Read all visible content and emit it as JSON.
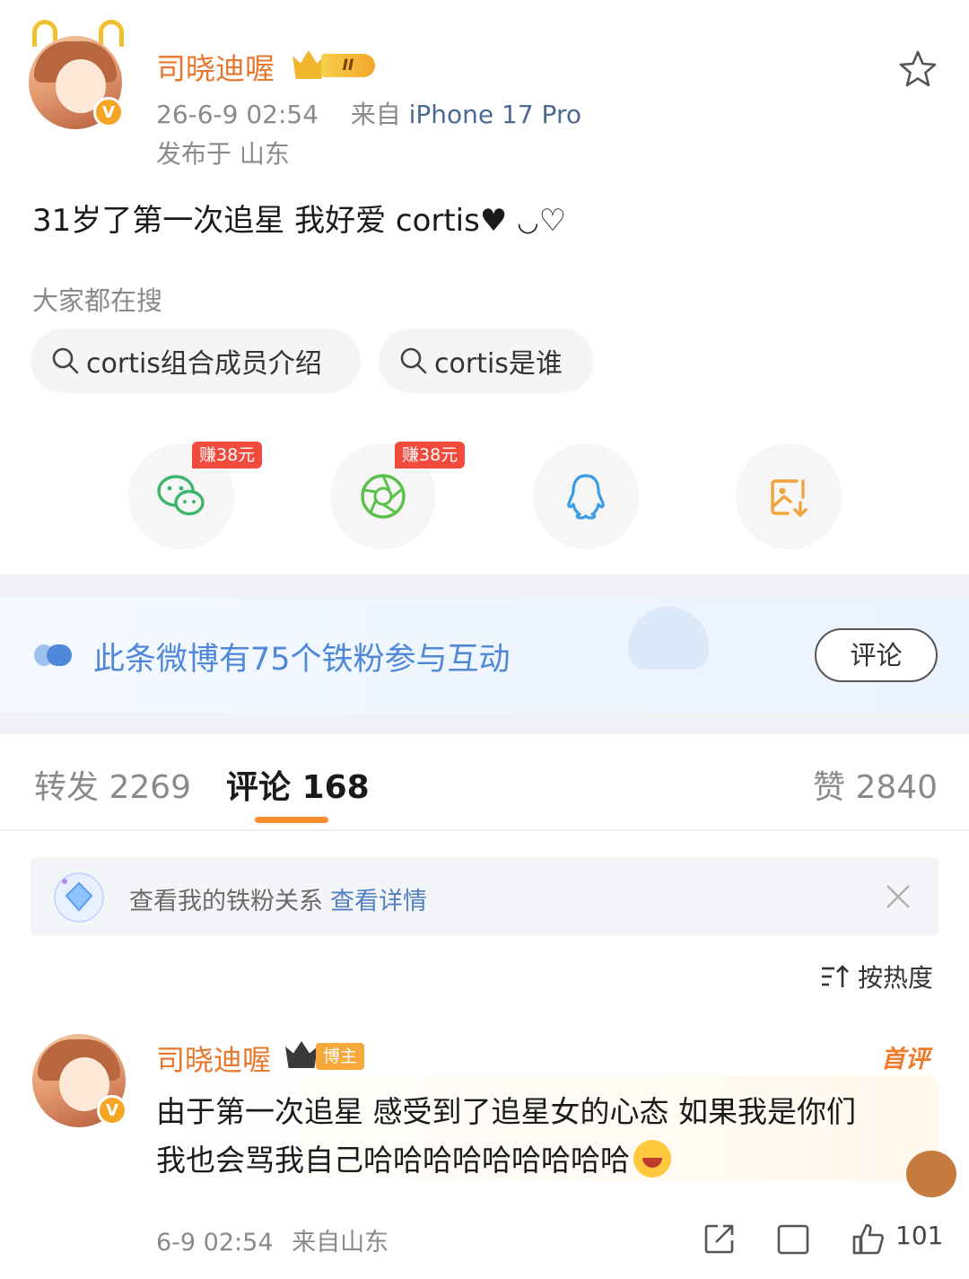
{
  "post": {
    "username": "司晓迪喔",
    "rank_badge": "II",
    "timestamp": "26-6-9 02:54",
    "from_prefix": "来自",
    "device": "iPhone 17 Pro",
    "published_in": "发布于 山东",
    "text": "31岁了第一次追星 我好爱 cortis",
    "text_suffix_icons": [
      "heart-filled",
      "smile",
      "heart-outline"
    ]
  },
  "search": {
    "heading": "大家都在搜",
    "chips": [
      "cortis组合成员介绍",
      "cortis是谁"
    ]
  },
  "share": {
    "buttons": [
      {
        "icon": "wechat-icon",
        "earn": "赚38元"
      },
      {
        "icon": "moments-icon",
        "earn": "赚38元"
      },
      {
        "icon": "qq-icon"
      },
      {
        "icon": "save-image-icon"
      }
    ]
  },
  "fan_banner": {
    "text": "此条微博有75个铁粉参与互动",
    "button": "评论"
  },
  "tabs": [
    {
      "label": "转发",
      "count": "2269"
    },
    {
      "label": "评论",
      "count": "168"
    },
    {
      "label": "赞",
      "count": "2840"
    }
  ],
  "notice": {
    "text": "查看我的铁粉关系",
    "link": "查看详情"
  },
  "sort": {
    "label": "按热度"
  },
  "comment": {
    "username": "司晓迪喔",
    "role_tag": "博主",
    "first_tag": "首评",
    "line1": "由于第一次追星 感受到了追星女的心态 如果我是你们",
    "line2": "我也会骂我自己哈哈哈哈哈哈哈哈哈",
    "time": "6-9 02:54",
    "from": "来自山东",
    "likes": "101"
  },
  "colors": {
    "accent_orange": "#e8772e",
    "link_blue": "#4f7fbf",
    "tab_indicator": "#f68f2c",
    "earn_red": "#f24a3c"
  }
}
